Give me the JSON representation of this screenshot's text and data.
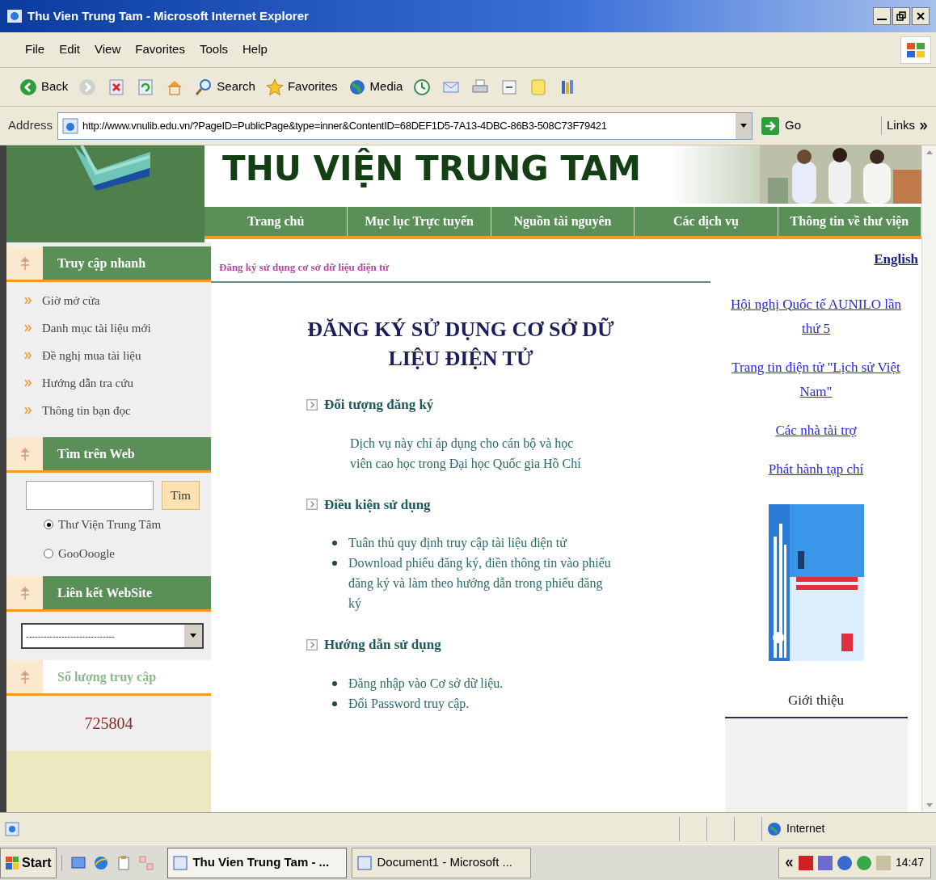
{
  "window": {
    "title": "Thu Vien Trung Tam - Microsoft Internet Explorer"
  },
  "menu_bar": [
    "File",
    "Edit",
    "View",
    "Favorites",
    "Tools",
    "Help"
  ],
  "toolbar": [
    {
      "kind": "back",
      "label": "Back"
    },
    {
      "kind": "forward"
    },
    {
      "kind": "stop"
    },
    {
      "kind": "refresh"
    },
    {
      "kind": "home"
    },
    {
      "kind": "search",
      "label": "Search"
    },
    {
      "kind": "favorites",
      "label": "Favorites"
    },
    {
      "kind": "media",
      "label": "Media"
    },
    {
      "kind": "history"
    },
    {
      "kind": "mail"
    },
    {
      "kind": "print"
    },
    {
      "kind": "edit"
    },
    {
      "kind": "note"
    },
    {
      "kind": "research"
    }
  ],
  "address_bar": {
    "label": "Address",
    "url": "http://www.vnulib.edu.vn/?PageID=PublicPage&type=inner&ContentID=68DEF1D5-7A13-4DBC-86B3-508C73F79421",
    "go": "Go",
    "links": "Links"
  },
  "site": {
    "title": "THU VIỆN TRUNG TAM",
    "nav": [
      "Trang chủ",
      "Mục lục Trực tuyến",
      "Nguồn tài nguyên",
      "Các dịch vụ",
      "Thông tin về thư viện"
    ]
  },
  "sidebar": [
    {
      "kind": "links",
      "title": "Truy cập nhanh",
      "items": [
        "Giờ mở cửa",
        "Danh mục tài liệu mới",
        "Đề nghị mua tài liệu",
        "Hướng dẫn tra cứu",
        "Thông tin bạn đọc"
      ]
    },
    {
      "kind": "search",
      "title": "Tìm trên Web",
      "button": "Tìm",
      "options": [
        {
          "label": "Thư Viện Trung Tâm",
          "selected": true
        },
        {
          "label": "GooOoogle",
          "selected": false
        }
      ]
    },
    {
      "kind": "select",
      "title": "Liên kết WebSite",
      "value": "------------------------------"
    },
    {
      "kind": "counter",
      "title": "Số lượng truy cập",
      "count": "725804"
    }
  ],
  "breadcrumb": "Đăng ký sử dụng cơ sở dữ liệu điện tử",
  "article": {
    "title": "ĐĂNG KÝ SỬ DỤNG CƠ SỞ DỮ LIỆU ĐIỆN TỬ",
    "sections": [
      {
        "kind": "paragraph",
        "heading": "Đối tượng đăng ký",
        "text": "Dịch vụ này chỉ áp dụng cho cán bộ và học viên cao học trong Đại học Quốc gia Hồ Chí"
      },
      {
        "kind": "bullets",
        "heading": "Điều kiện sử dụng",
        "items": [
          "Tuân thủ quy định truy cập tài liệu điện tử",
          "Download phiếu đăng ký, điền thông tin vào phiếu đăng ký và làm theo hướng dẫn trong phiếu đăng ký"
        ]
      },
      {
        "kind": "bullets",
        "heading": "Hướng dẫn sử dụng",
        "items": [
          "Đăng nhập vào Cơ sở dữ liệu.",
          "Đổi Password truy cập."
        ]
      }
    ]
  },
  "right_column": {
    "language_link": "English",
    "links": [
      "Hội nghị Quốc tế AUNILO lần thứ 5",
      "Trang tin điện tử \"Lịch sử Việt Nam\"",
      "Các nhà tài trợ",
      "Phát hành tạp chí"
    ],
    "intro_heading": "Giới thiệu"
  },
  "status_bar": {
    "zone": "Internet"
  },
  "taskbar": {
    "start": "Start",
    "tasks": [
      {
        "label": "Thu Vien Trung Tam - ...",
        "selected": true
      },
      {
        "label": "Document1 - Microsoft ...",
        "selected": false
      }
    ],
    "clock": "14:47"
  }
}
